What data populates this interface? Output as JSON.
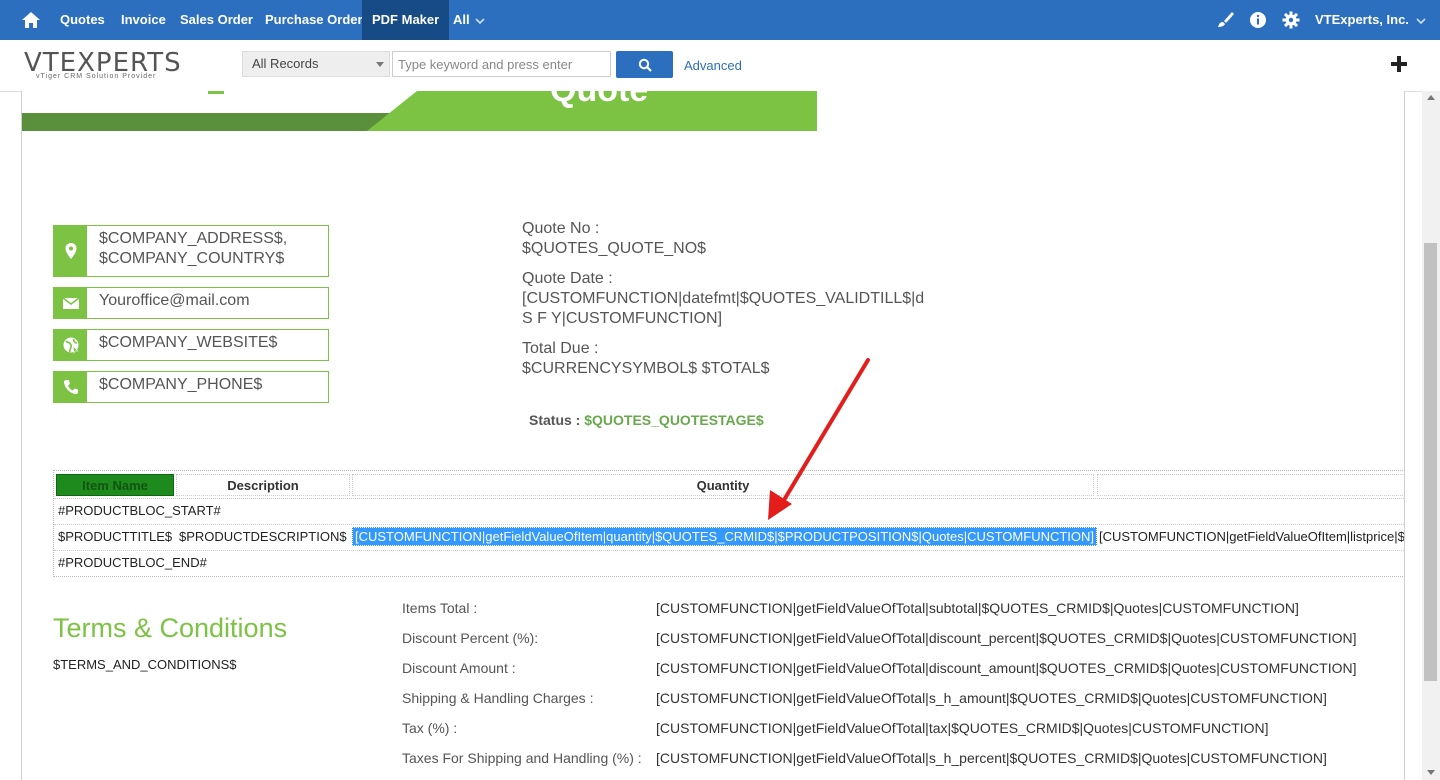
{
  "topnav": {
    "items": [
      "Quotes",
      "Invoice",
      "Sales Order",
      "Purchase Order",
      "PDF Maker",
      "All"
    ],
    "active": "PDF Maker",
    "company": "VTExperts, Inc.",
    "icons": [
      "home-icon",
      "brush-icon",
      "info-icon",
      "gear-icon"
    ]
  },
  "logo": {
    "main": "VTEXPERTS",
    "tagline": "vTiger CRM Solution Provider"
  },
  "search": {
    "filter_value": "All Records",
    "placeholder": "Type keyword and press enter",
    "advanced_label": "Advanced"
  },
  "header_banner": {
    "title": "Quote"
  },
  "company_info": {
    "address": [
      "$COMPANY_ADDRESS$,",
      "$COMPANY_COUNTRY$"
    ],
    "email": "Youroffice@mail.com",
    "website": "$COMPANY_WEBSITE$",
    "phone": "$COMPANY_PHONE$"
  },
  "quote_details": {
    "no_label": "Quote No :",
    "no_value": "$QUOTES_QUOTE_NO$",
    "date_label": "Quote Date :",
    "date_value_line1": "[CUSTOMFUNCTION|datefmt|$QUOTES_VALIDTILL$|d",
    "date_value_line2": "S F Y|CUSTOMFUNCTION]",
    "due_label": "Total Due :",
    "due_value": "$CURRENCYSYMBOL$ $TOTAL$",
    "status_label": "Status : ",
    "status_value": "$QUOTES_QUOTESTAGE$"
  },
  "product_table": {
    "headers": [
      "Item Name",
      "Description",
      "Quantity"
    ],
    "bloc_start": "#PRODUCTBLOC_START#",
    "row": [
      "$PRODUCTTITLE$",
      "$PRODUCTDESCRIPTION$",
      "[CUSTOMFUNCTION|getFieldValueOfItem|quantity|$QUOTES_CRMID$|$PRODUCTPOSITION$|Quotes|CUSTOMFUNCTION]",
      "[CUSTOMFUNCTION|getFieldValueOfItem|listprice|$"
    ],
    "bloc_end": "#PRODUCTBLOC_END#"
  },
  "terms": {
    "title": "Terms & Conditions",
    "value": "$TERMS_AND_CONDITIONS$"
  },
  "totals": [
    {
      "label": "Items Total :",
      "value": "[CUSTOMFUNCTION|getFieldValueOfTotal|subtotal|$QUOTES_CRMID$|Quotes|CUSTOMFUNCTION]"
    },
    {
      "label": "Discount Percent (%):",
      "value": "[CUSTOMFUNCTION|getFieldValueOfTotal|discount_percent|$QUOTES_CRMID$|Quotes|CUSTOMFUNCTION]"
    },
    {
      "label": "Discount Amount :",
      "value": "[CUSTOMFUNCTION|getFieldValueOfTotal|discount_amount|$QUOTES_CRMID$|Quotes|CUSTOMFUNCTION]"
    },
    {
      "label": "Shipping & Handling Charges :",
      "value": "[CUSTOMFUNCTION|getFieldValueOfTotal|s_h_amount|$QUOTES_CRMID$|Quotes|CUSTOMFUNCTION]"
    },
    {
      "label": "Tax (%) :",
      "value": "[CUSTOMFUNCTION|getFieldValueOfTotal|tax|$QUOTES_CRMID$|Quotes|CUSTOMFUNCTION]"
    },
    {
      "label": "Taxes For Shipping and Handling (%) :",
      "value": "[CUSTOMFUNCTION|getFieldValueOfTotal|s_h_percent|$QUOTES_CRMID$|Quotes|CUSTOMFUNCTION]"
    }
  ],
  "colors": {
    "nav_bg": "#2c6fbe",
    "nav_active": "#164b85",
    "brand_green": "#7cc243",
    "dark_green": "#5a8f3c",
    "status_green": "#6aa84f",
    "item_header_bg": "#1e8a1e",
    "selection": "#3399ff",
    "annotation_arrow": "#e31c1c"
  }
}
